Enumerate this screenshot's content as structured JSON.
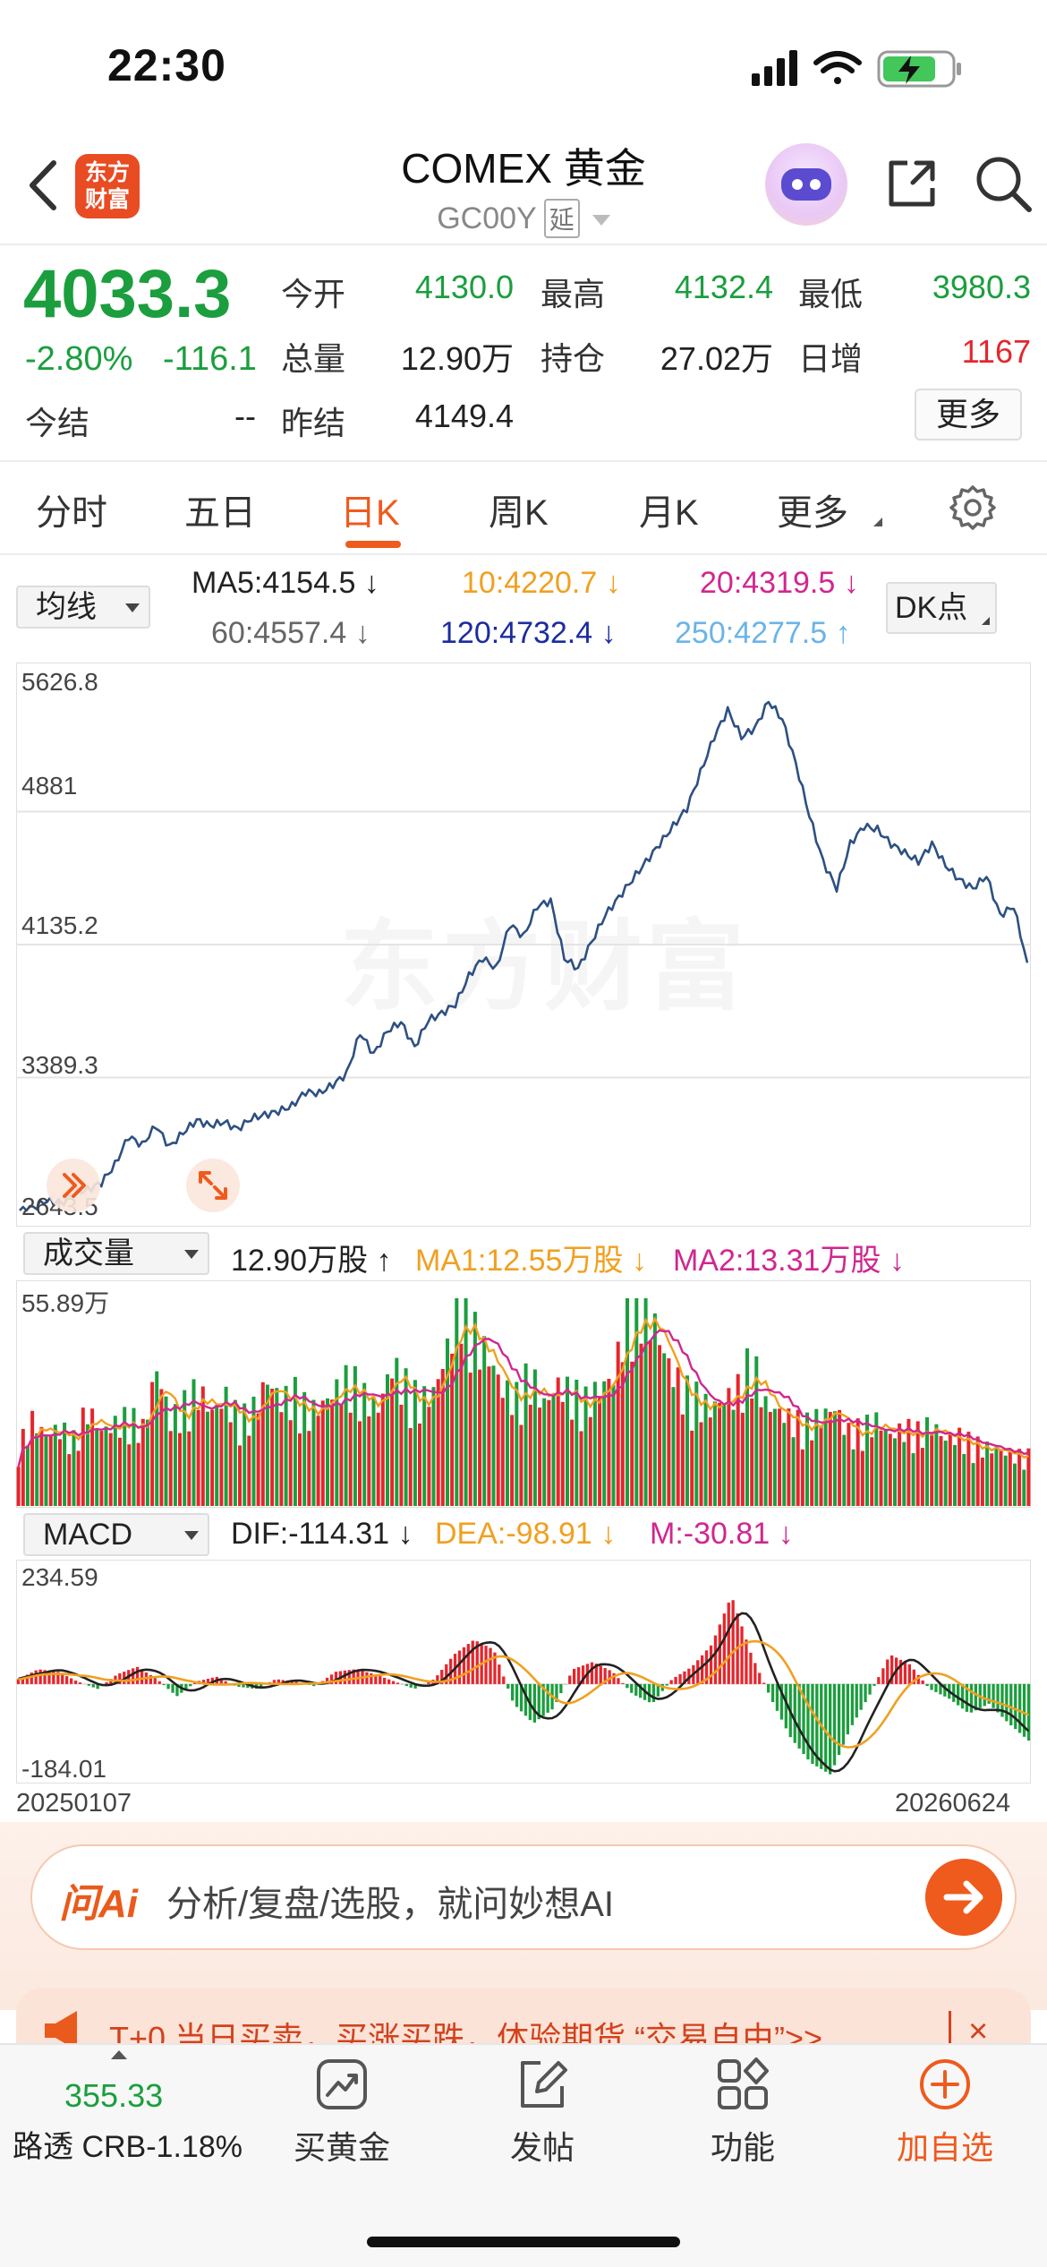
{
  "status": {
    "time": "22:30"
  },
  "header": {
    "title": "COMEX 黄金",
    "code": "GC00Y",
    "tag": "延",
    "logo_line1": "东方",
    "logo_line2": "财富"
  },
  "quote": {
    "price": "4033.3",
    "change_pct": "-2.80%",
    "change": "-116.1",
    "rows": [
      [
        {
          "label": "今开",
          "value": "4130.0",
          "color": "green"
        },
        {
          "label": "最高",
          "value": "4132.4",
          "color": "green"
        },
        {
          "label": "最低",
          "value": "3980.3",
          "color": "green"
        }
      ],
      [
        {
          "label": "总量",
          "value": "12.90万",
          "color": "dark"
        },
        {
          "label": "持仓",
          "value": "27.02万",
          "color": "dark"
        },
        {
          "label": "日增",
          "value": "1167",
          "color": "red"
        }
      ],
      [
        {
          "label": "今结",
          "value": "--",
          "color": "dark"
        },
        {
          "label": "昨结",
          "value": "4149.4",
          "color": "dark"
        }
      ]
    ],
    "more_label": "更多"
  },
  "tabs": [
    "分时",
    "五日",
    "日K",
    "周K",
    "月K",
    "更多"
  ],
  "active_tab": "日K",
  "ma": {
    "selector": "均线",
    "items": [
      {
        "text": "MA5:4154.5 ↓",
        "color": "#222222"
      },
      {
        "text": "10:4220.7 ↓",
        "color": "#f0a020"
      },
      {
        "text": "20:4319.5 ↓",
        "color": "#d0278f"
      },
      {
        "text": "60:4557.4 ↓",
        "color": "#666666"
      },
      {
        "text": "120:4732.4 ↓",
        "color": "#1c2c9e"
      },
      {
        "text": "250:4277.5 ↑",
        "color": "#6ab4e8"
      }
    ],
    "dk_label": "DK点"
  },
  "watermark": "东方财富",
  "volume": {
    "selector": "成交量",
    "items": [
      {
        "text": "12.90万股 ↑",
        "color": "#222222"
      },
      {
        "text": "MA1:12.55万股 ↓",
        "color": "#f0a020"
      },
      {
        "text": "MA2:13.31万股 ↓",
        "color": "#d0278f"
      }
    ],
    "max_label": "55.89万"
  },
  "macd": {
    "selector": "MACD",
    "items": [
      {
        "text": "DIF:-114.31 ↓",
        "color": "#222222"
      },
      {
        "text": "DEA:-98.91 ↓",
        "color": "#f0a020"
      },
      {
        "text": "M:-30.81 ↓",
        "color": "#d0278f"
      }
    ],
    "max_label": "234.59",
    "min_label": "-184.01"
  },
  "dates": {
    "start": "20250107",
    "end": "20260624"
  },
  "ai": {
    "logo": "问Ai",
    "placeholder": "分析/复盘/选股，就问妙想AI"
  },
  "banner": {
    "text": "T+0 当日买卖，买涨买跌，体验期货 “交易自由”>>",
    "close": "×"
  },
  "bottom_nav": {
    "index_value": "355.33",
    "index_name": "路透 CRB-1.18%",
    "items": [
      "买黄金",
      "发帖",
      "功能",
      "加自选"
    ]
  },
  "colors": {
    "up": "#e5262c",
    "down": "#1b9e3e",
    "accent": "#ef5a1d",
    "price_line": "#2d5082"
  },
  "chart_data": [
    {
      "type": "line",
      "title": "",
      "series": [
        {
          "name": "",
          "values": [
            2643,
            2660,
            2700,
            2680,
            2740,
            2760,
            2800,
            2900,
            3060,
            3010,
            3120,
            3000,
            3080,
            3150,
            3120,
            3140,
            3100,
            3160,
            3180,
            3200,
            3230,
            3310,
            3300,
            3350,
            3410,
            3640,
            3520,
            3650,
            3700,
            3560,
            3710,
            3750,
            3800,
            3960,
            4060,
            4000,
            4250,
            4180,
            4350,
            4380,
            4060,
            4000,
            4150,
            4300,
            4400,
            4500,
            4600,
            4700,
            4800,
            4900,
            5100,
            5300,
            5450,
            5300,
            5350,
            5500,
            5400,
            5150,
            4860,
            4600,
            4450,
            4700,
            4800,
            4780,
            4700,
            4650,
            4600,
            4700,
            4580,
            4500,
            4450,
            4520,
            4300,
            4350,
            4033
          ]
        }
      ],
      "ylim": [
        2643.5,
        5626.8
      ],
      "yticks": [
        5626.8,
        4881.0,
        4135.2,
        3389.3,
        2643.5
      ],
      "x_range": [
        "20250107",
        "20260624"
      ]
    },
    {
      "type": "bar",
      "title": "",
      "series": [
        {
          "name": "",
          "values": [
            15,
            22,
            18,
            20,
            17,
            25,
            19,
            21,
            23,
            20,
            35,
            22,
            26,
            30,
            24,
            28,
            22,
            25,
            32,
            27,
            29,
            24,
            26,
            30,
            33,
            28,
            25,
            36,
            31,
            27,
            29,
            40,
            55.89,
            44,
            38,
            30,
            28,
            34,
            26,
            31,
            29,
            27,
            30,
            33,
            50,
            55.89,
            46,
            36,
            30,
            28,
            25,
            27,
            30,
            38,
            26,
            24,
            22,
            21,
            23,
            25,
            19,
            20,
            22,
            18,
            20,
            19,
            21,
            17,
            18,
            16,
            15,
            14,
            13,
            12.9
          ]
        }
      ],
      "ylim": [
        0,
        55.89
      ]
    },
    {
      "type": "bar",
      "title": "",
      "series": [
        {
          "name": "",
          "values": [
            10,
            30,
            25,
            5,
            -10,
            20,
            35,
            10,
            -25,
            5,
            15,
            -5,
            -10,
            10,
            5,
            -5,
            25,
            30,
            20,
            5,
            -10,
            10,
            60,
            90,
            70,
            -40,
            -80,
            -50,
            30,
            45,
            25,
            -20,
            -40,
            10,
            35,
            80,
            180,
            60,
            -30,
            -110,
            -160,
            -184,
            -90,
            -20,
            60,
            40,
            -10,
            -30,
            -60,
            -40,
            -80,
            -115
          ]
        }
      ],
      "ylim": [
        -184.01,
        234.59
      ]
    }
  ]
}
